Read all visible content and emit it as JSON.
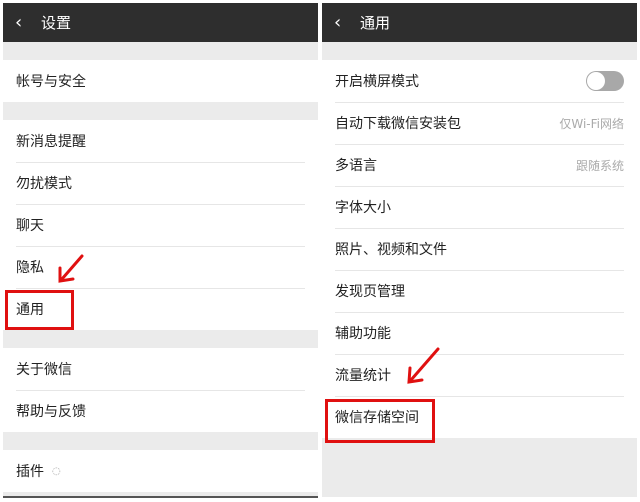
{
  "left": {
    "title": "设置",
    "groups": [
      [
        "帐号与安全"
      ],
      [
        "新消息提醒",
        "勿扰模式",
        "聊天",
        "隐私",
        "通用"
      ],
      [
        "关于微信",
        "帮助与反馈"
      ],
      [
        "插件"
      ]
    ]
  },
  "right": {
    "title": "通用",
    "items": [
      {
        "label": "开启横屏模式",
        "toggle": false
      },
      {
        "label": "自动下载微信安装包",
        "value": "仅Wi-Fi网络"
      },
      {
        "label": "多语言",
        "value": "跟随系统"
      },
      {
        "label": "字体大小"
      },
      {
        "label": "照片、视频和文件"
      },
      {
        "label": "发现页管理"
      },
      {
        "label": "辅助功能"
      },
      {
        "label": "流量统计"
      },
      {
        "label": "微信存储空间"
      }
    ]
  },
  "colors": {
    "header": "#2e2e2e",
    "annotation": "#e01010"
  }
}
